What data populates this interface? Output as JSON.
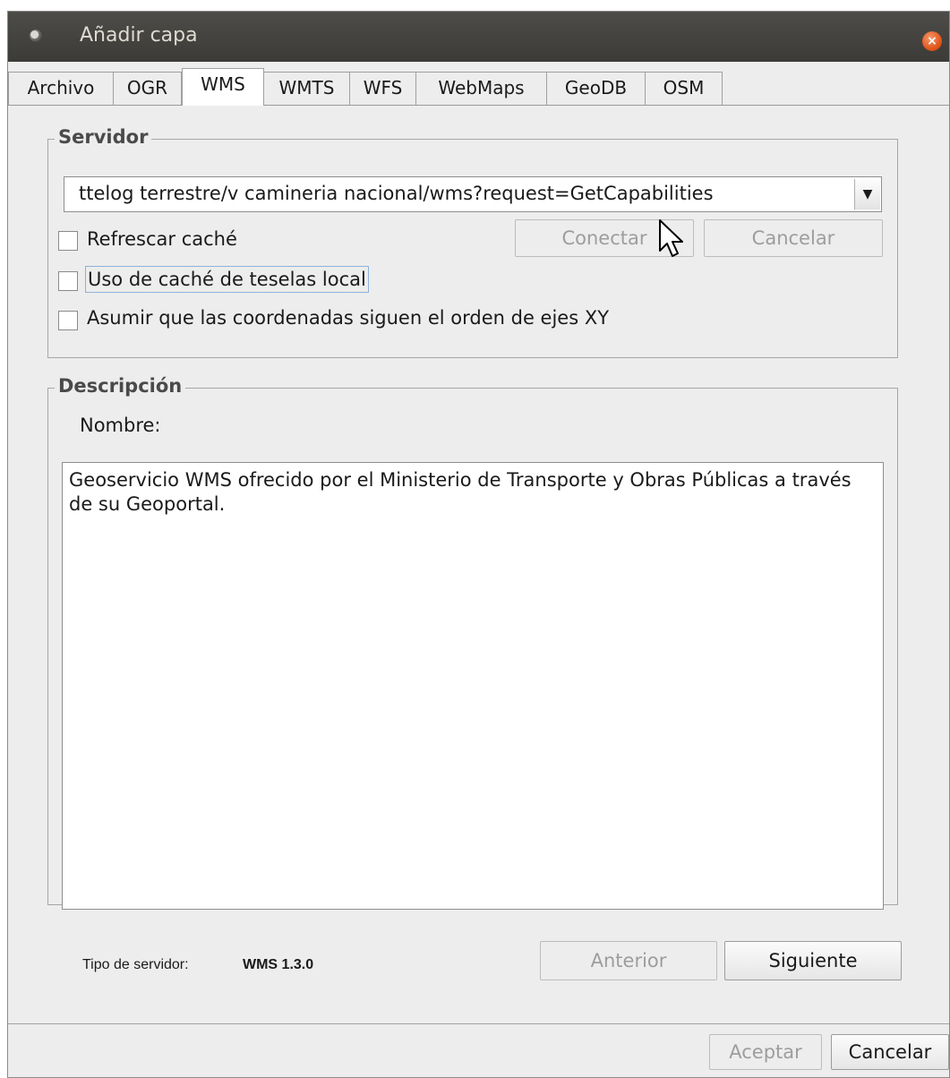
{
  "window": {
    "title": "Añadir capa",
    "close_glyph": "×"
  },
  "tabs": [
    {
      "label": "Archivo",
      "active": false
    },
    {
      "label": "OGR",
      "active": false
    },
    {
      "label": "WMS",
      "active": true
    },
    {
      "label": "WMTS",
      "active": false
    },
    {
      "label": "WFS",
      "active": false
    },
    {
      "label": "WebMaps",
      "active": false
    },
    {
      "label": "GeoDB",
      "active": false
    },
    {
      "label": "OSM",
      "active": false
    }
  ],
  "servidor": {
    "group_title": "Servidor",
    "url_value": "ttelog terrestre/v camineria nacional/wms?request=GetCapabilities",
    "dropdown_icon": "chevron-down-icon",
    "refresh_cache_label": "Refrescar caché",
    "local_tile_cache_label": "Uso de caché de teselas local",
    "xy_axis_label": "Asumir que las coordenadas siguen el orden de ejes XY",
    "connect_label": "Conectar",
    "cancel_label": "Cancelar"
  },
  "descripcion": {
    "group_title": "Descripción",
    "name_label": "Nombre:",
    "text": "Geoservicio WMS ofrecido por el Ministerio de Transporte y Obras Públicas a través de su Geoportal."
  },
  "footer": {
    "server_type_label": "Tipo de servidor:",
    "server_type_value": "WMS 1.3.0",
    "previous_label": "Anterior",
    "next_label": "Siguiente"
  },
  "dialog_buttons": {
    "accept_label": "Aceptar",
    "cancel_label": "Cancelar"
  },
  "colors": {
    "titlebar": "#3c3b37",
    "close_button": "#e2571e",
    "window_bg": "#ededed"
  }
}
